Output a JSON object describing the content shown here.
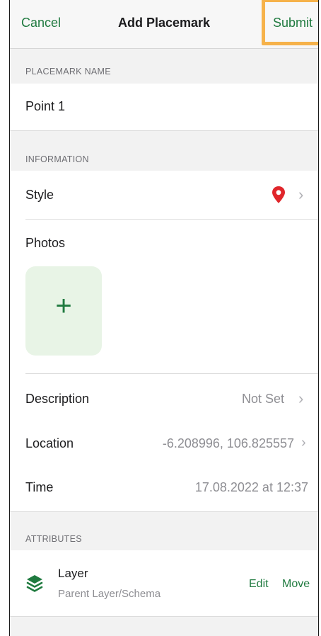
{
  "nav": {
    "cancel": "Cancel",
    "title": "Add Placemark",
    "submit": "Submit"
  },
  "sections": {
    "name_header": "PLACEMARK NAME",
    "information_header": "INFORMATION",
    "attributes_header": "ATTRIBUTES"
  },
  "placemark_name": "Point 1",
  "information": {
    "style_label": "Style",
    "photos_label": "Photos",
    "add_photo": "+",
    "description_label": "Description",
    "description_value": "Not Set",
    "location_label": "Location",
    "location_value": "-6.208996, 106.825557",
    "time_label": "Time",
    "time_value": "17.08.2022 at 12:37"
  },
  "attributes": {
    "layer_title": "Layer",
    "layer_subtitle": "Parent Layer/Schema",
    "edit": "Edit",
    "move": "Move"
  },
  "colors": {
    "accent": "#1f7a3f",
    "highlight": "#f6b24a",
    "pin": "#e0262b"
  },
  "icons": {
    "style": "map-pin-icon",
    "chevron": "chevron-right-icon",
    "layer": "layers-icon"
  }
}
